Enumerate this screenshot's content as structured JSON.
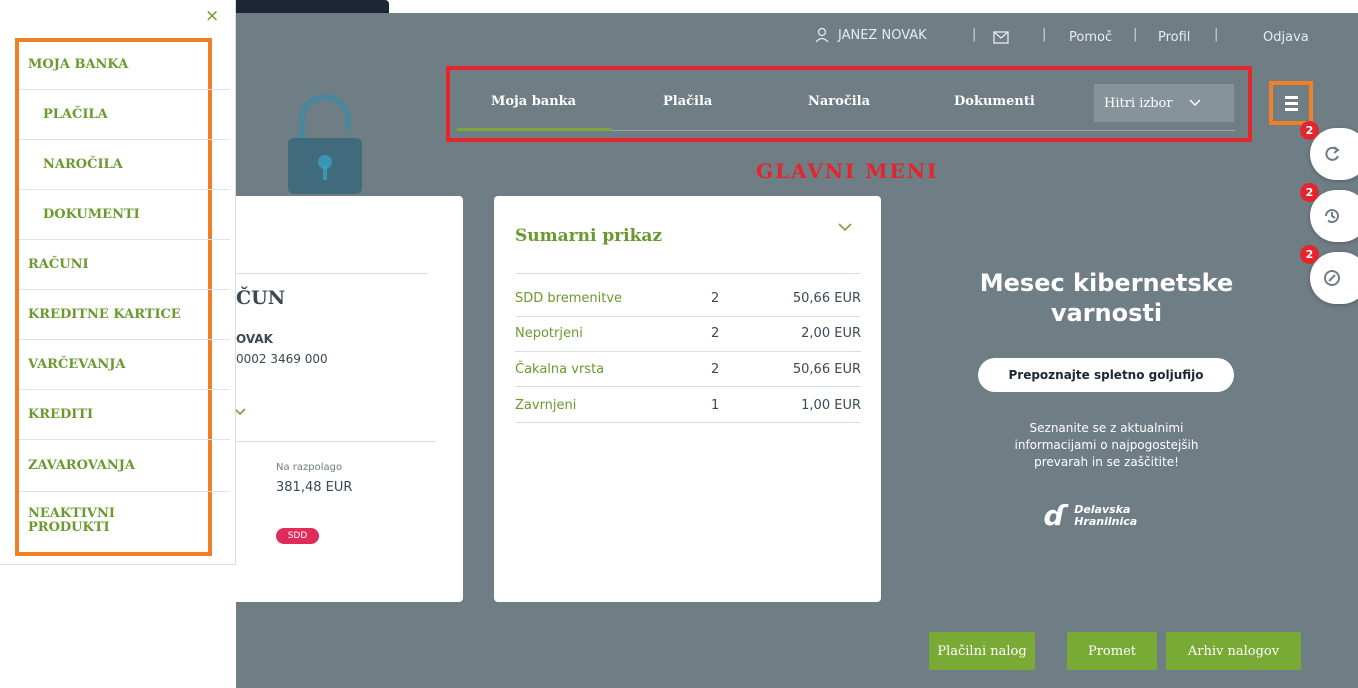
{
  "header": {
    "user_name": "JANEZ NOVAK",
    "sep1": "|",
    "sep2": "|",
    "sep3": "|",
    "sep4": "|",
    "help": "Pomoč",
    "profile": "Profil",
    "logout": "Odjava"
  },
  "nav": {
    "items": [
      "Moja banka",
      "Plačila",
      "Naročila",
      "Dokumenti"
    ],
    "quick_select": "Hitri izbor",
    "annotation": "GLAVNI MENI"
  },
  "side_buttons": {
    "badges": [
      "2",
      "2",
      "2"
    ]
  },
  "account_card": {
    "title": "ČUN",
    "owner": "OVAK",
    "iban": "0002 3469 000",
    "available_label": "Na razpolago",
    "available_amount": "381,48 EUR",
    "badge": "SDD"
  },
  "summary": {
    "title": "Sumarni prikaz",
    "rows": [
      {
        "label": "SDD bremenitve",
        "count": "2",
        "amount": "50,66 EUR"
      },
      {
        "label": "Nepotrjeni",
        "count": "2",
        "amount": "2,00 EUR"
      },
      {
        "label": "Čakalna vrsta",
        "count": "2",
        "amount": "50,66 EUR"
      },
      {
        "label": "Zavrnjeni",
        "count": "1",
        "amount": "1,00 EUR"
      }
    ]
  },
  "promo": {
    "title_line1": "Mesec kibernetske",
    "title_line2": "varnosti",
    "button": "Prepoznajte spletno goljufijo",
    "text_line1": "Seznanite se z aktualnimi",
    "text_line2": "informacijami o najpogostejših",
    "text_line3": "prevarah in se zaščitite!",
    "brand_line1": "Delavska",
    "brand_line2": "Hranilnica"
  },
  "actions": {
    "payment_order": "Plačilni nalog",
    "turnover": "Promet",
    "archive": "Arhiv nalogov"
  },
  "drawer": {
    "close": "×",
    "items": [
      "MOJA BANKA",
      "PLAČILA",
      "NAROČILA",
      "DOKUMENTI",
      "RAČUNI",
      "KREDITNE KARTICE",
      "VARČEVANJA",
      "KREDITI",
      "ZAVAROVANJA",
      "NEAKTIVNI PRODUKTI"
    ]
  },
  "colors": {
    "background": "#6f7d84",
    "accent_green": "#7aaa36",
    "highlight_red": "#e3262e",
    "highlight_orange": "#f07f25"
  }
}
